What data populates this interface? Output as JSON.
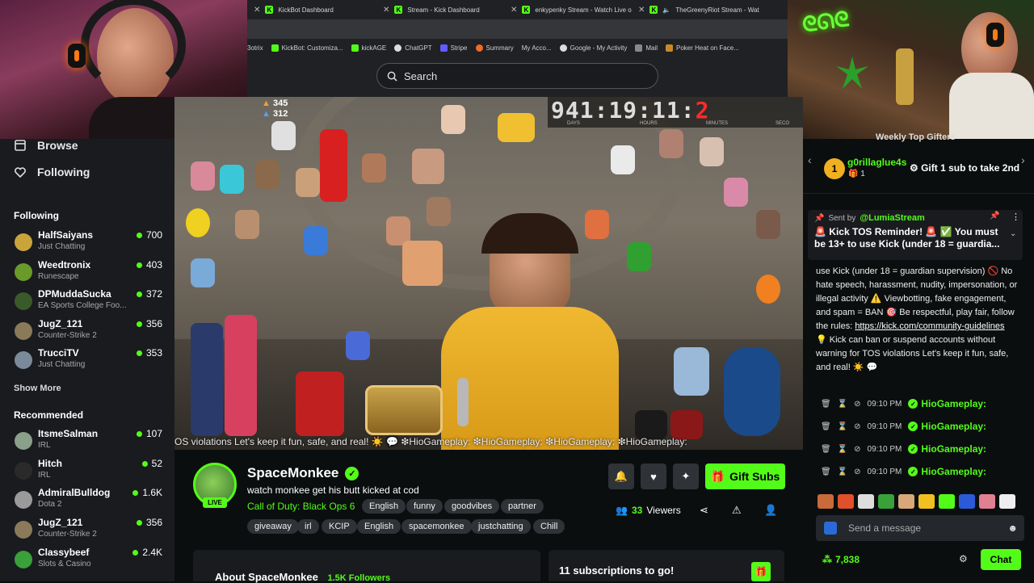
{
  "browser": {
    "tabs": [
      {
        "label": "KickBot Dashboard"
      },
      {
        "label": "Stream - Kick Dashboard"
      },
      {
        "label": "enkypenky Stream - Watch Live o"
      },
      {
        "label": "TheGreenyRiot Stream - Wat"
      }
    ],
    "bookmarks": [
      "3otrix",
      "KickBot: Customiza...",
      "kickAGE",
      "ChatGPT",
      "Stripe",
      "Summary",
      "My Acco...",
      "Google - My Activity",
      "Mail",
      "Poker Heat on Face..."
    ],
    "search_placeholder": "Search"
  },
  "sidebar": {
    "browse": "Browse",
    "following_nav": "Following",
    "following_title": "Following",
    "following": [
      {
        "name": "HalfSaiyans",
        "game": "Just Chatting",
        "viewers": "700",
        "color": "#c9a43a"
      },
      {
        "name": "Weedtronix",
        "game": "Runescape",
        "viewers": "403",
        "color": "#6a9a2a"
      },
      {
        "name": "DPMuddaSucka",
        "game": "EA Sports College Foo...",
        "viewers": "372",
        "color": "#3a5a2a"
      },
      {
        "name": "JugZ_121",
        "game": "Counter-Strike 2",
        "viewers": "356",
        "color": "#8a7a5a"
      },
      {
        "name": "TrucciTV",
        "game": "Just Chatting",
        "viewers": "353",
        "color": "#7a8a9a"
      }
    ],
    "show_more": "Show More",
    "recommended_title": "Recommended",
    "recommended": [
      {
        "name": "ItsmeSalman",
        "game": "IRL",
        "viewers": "107",
        "color": "#8aa08a"
      },
      {
        "name": "Hitch",
        "game": "IRL",
        "viewers": "52",
        "color": "#2a2a2a"
      },
      {
        "name": "AdmiralBulldog",
        "game": "Dota 2",
        "viewers": "1.6K",
        "color": "#9a9a9a"
      },
      {
        "name": "JugZ_121",
        "game": "Counter-Strike 2",
        "viewers": "356",
        "color": "#8a7a5a"
      },
      {
        "name": "Classybeef",
        "game": "Slots & Casino",
        "viewers": "2.4K",
        "color": "#3aa03a"
      }
    ]
  },
  "video": {
    "count_a": "345",
    "count_b": "312",
    "timer_days": "941",
    "timer_hours": "19",
    "timer_minutes": "11",
    "timer_seconds": "2",
    "label_days": "DAYS",
    "label_hours": "HOURS",
    "label_minutes": "MINUTES",
    "label_seconds": "SECO",
    "ticker": "OS violations Let's keep it fun, safe, and real! ☀️ 💬 ❇HioGameplay: ❇HioGameplay: ❇HioGameplay: ❇HioGameplay:"
  },
  "channel": {
    "live_label": "LIVE",
    "name": "SpaceMonkee",
    "title": "watch monkee get his butt kicked at cod",
    "category": "Call of Duty: Black Ops 6",
    "tags_row1": [
      "English",
      "funny",
      "goodvibes",
      "partner"
    ],
    "tags_row2": [
      "giveaway",
      "irl",
      "KCIP",
      "English",
      "spacemonkee",
      "justchatting",
      "Chill"
    ],
    "gift_subs_label": "Gift Subs",
    "viewer_count": "33",
    "viewers_label": "Viewers",
    "about_label": "About SpaceMonkee",
    "followers_label": "1.5K Followers",
    "subs_goal": "11 subscriptions to go!"
  },
  "chat": {
    "gifters_title": "Weekly Top Gifters",
    "top_gifter_rank": "1",
    "top_gifter_name": "g0rillaglue4s",
    "top_gifter_count": "1",
    "gift_prompt": "Gift 1 sub to take 2nd",
    "pinned_sent_by": "Sent by",
    "pinned_user": "@LumiaStream",
    "pinned_text": "🚨 Kick TOS Reminder! 🚨 ✅ You must be 13+ to use Kick (under 18 = guardia...",
    "message_part1": "use Kick (under 18 = guardian supervision) 🚫 No hate speech, harassment, nudity, impersonation, or illegal activity ⚠️ Viewbotting, fake engagement, and spam = BAN 🎯 Be respectful, play fair, follow the rules:",
    "message_link": "https://kick.com/community-guidelines",
    "message_part2": "💡 Kick can ban or suspend accounts without warning for TOS violations Let's keep it fun, safe, and real! ☀️ 💬",
    "rows": [
      {
        "time": "09:10 PM",
        "user": "HioGameplay:"
      },
      {
        "time": "09:10 PM",
        "user": "HioGameplay:"
      },
      {
        "time": "09:10 PM",
        "user": "HioGameplay:"
      },
      {
        "time": "09:10 PM",
        "user": "HioGameplay:"
      }
    ],
    "input_placeholder": "Send a message",
    "points": "7,838",
    "chat_button": "Chat"
  }
}
